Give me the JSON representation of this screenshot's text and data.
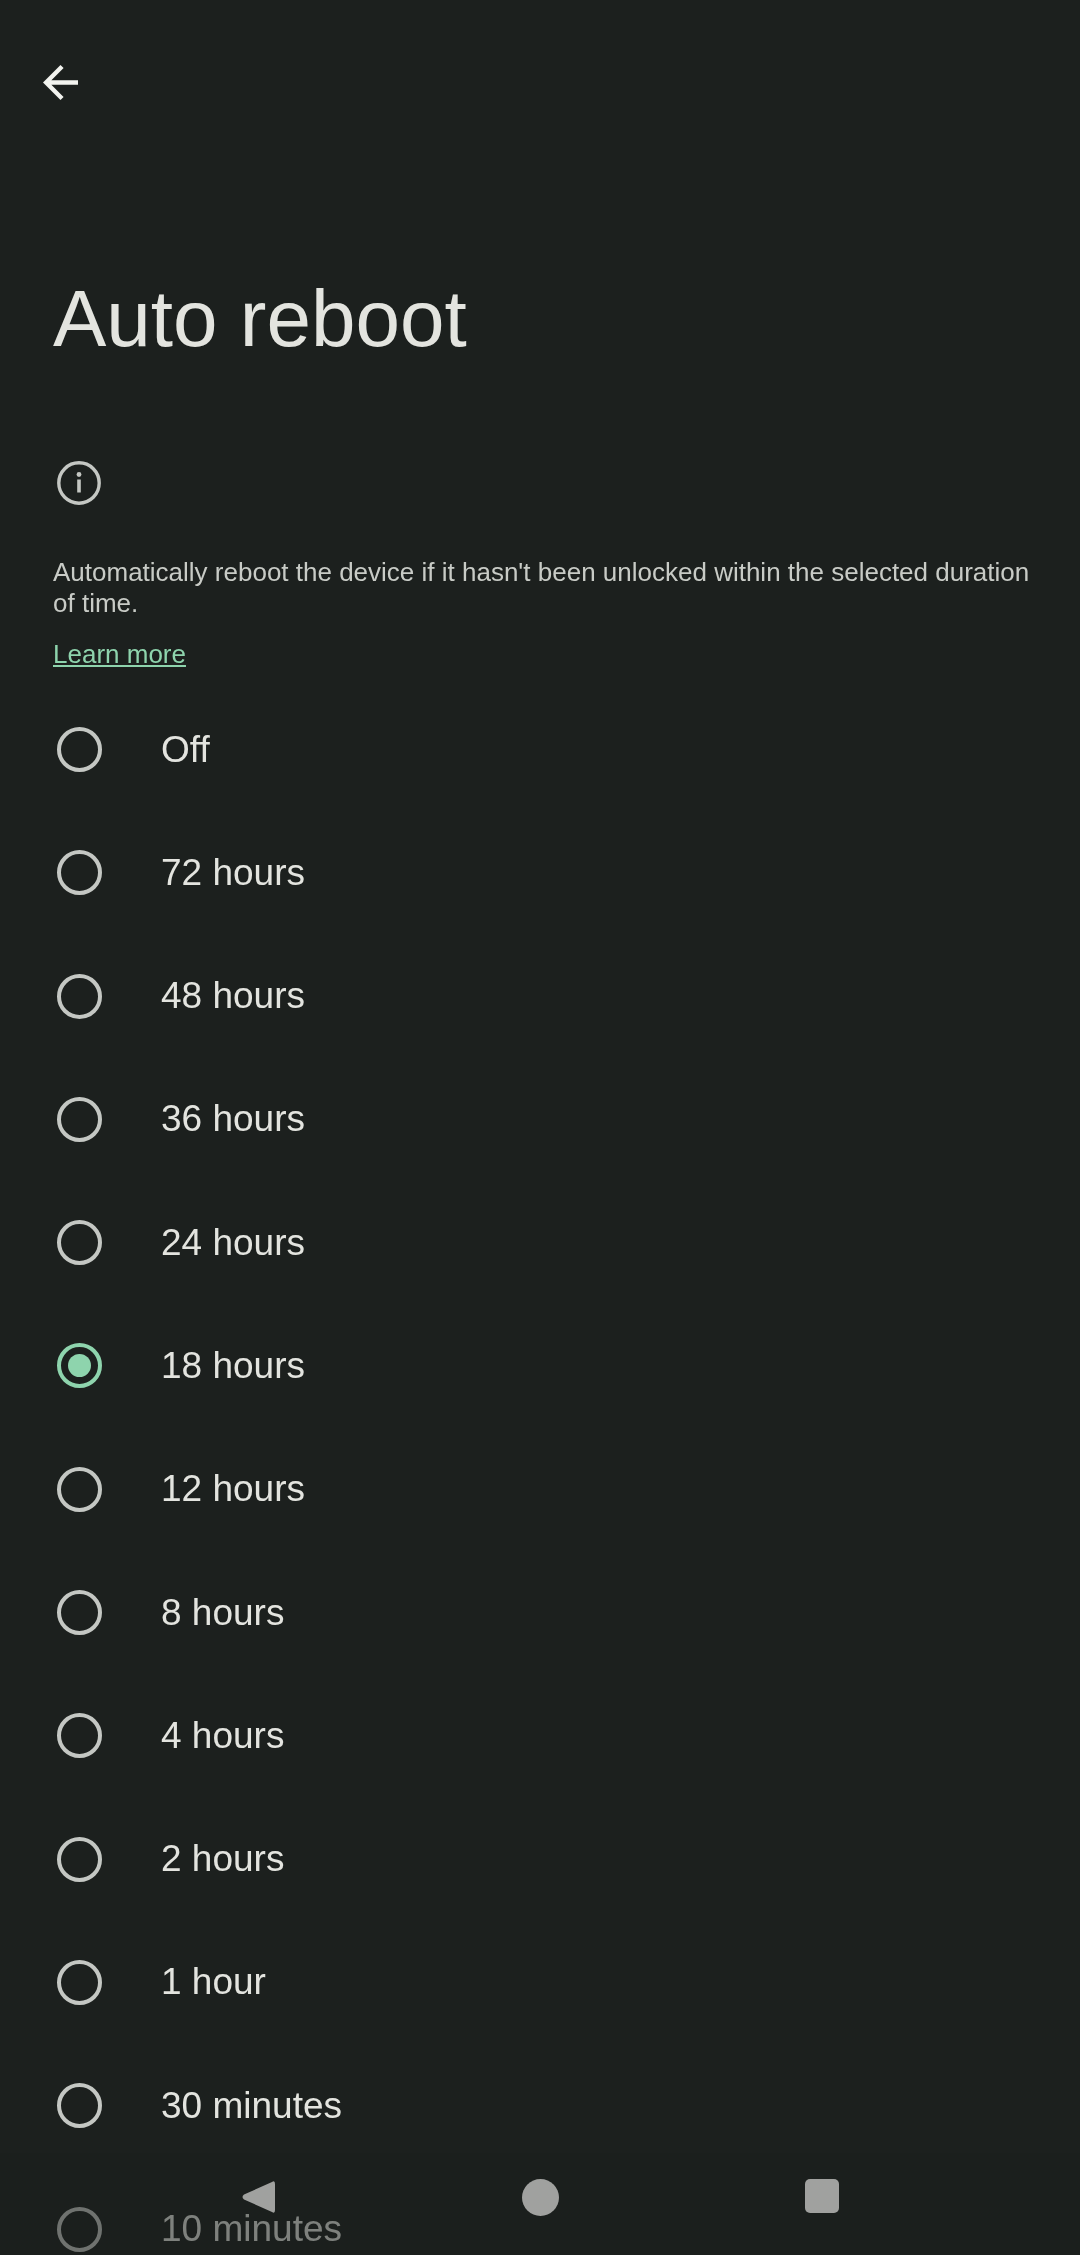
{
  "title": "Auto reboot",
  "description": {
    "text": "Automatically reboot the device if it hasn't been unlocked within the selected duration of time.",
    "link": "Learn more"
  },
  "options": [
    {
      "label": "Off",
      "selected": false
    },
    {
      "label": "72 hours",
      "selected": false
    },
    {
      "label": "48 hours",
      "selected": false
    },
    {
      "label": "36 hours",
      "selected": false
    },
    {
      "label": "24 hours",
      "selected": false
    },
    {
      "label": "18 hours",
      "selected": true
    },
    {
      "label": "12 hours",
      "selected": false
    },
    {
      "label": "8 hours",
      "selected": false
    },
    {
      "label": "4 hours",
      "selected": false
    },
    {
      "label": "2 hours",
      "selected": false
    },
    {
      "label": "1 hour",
      "selected": false
    },
    {
      "label": "30 minutes",
      "selected": false
    },
    {
      "label": "10 minutes",
      "selected": false
    }
  ]
}
